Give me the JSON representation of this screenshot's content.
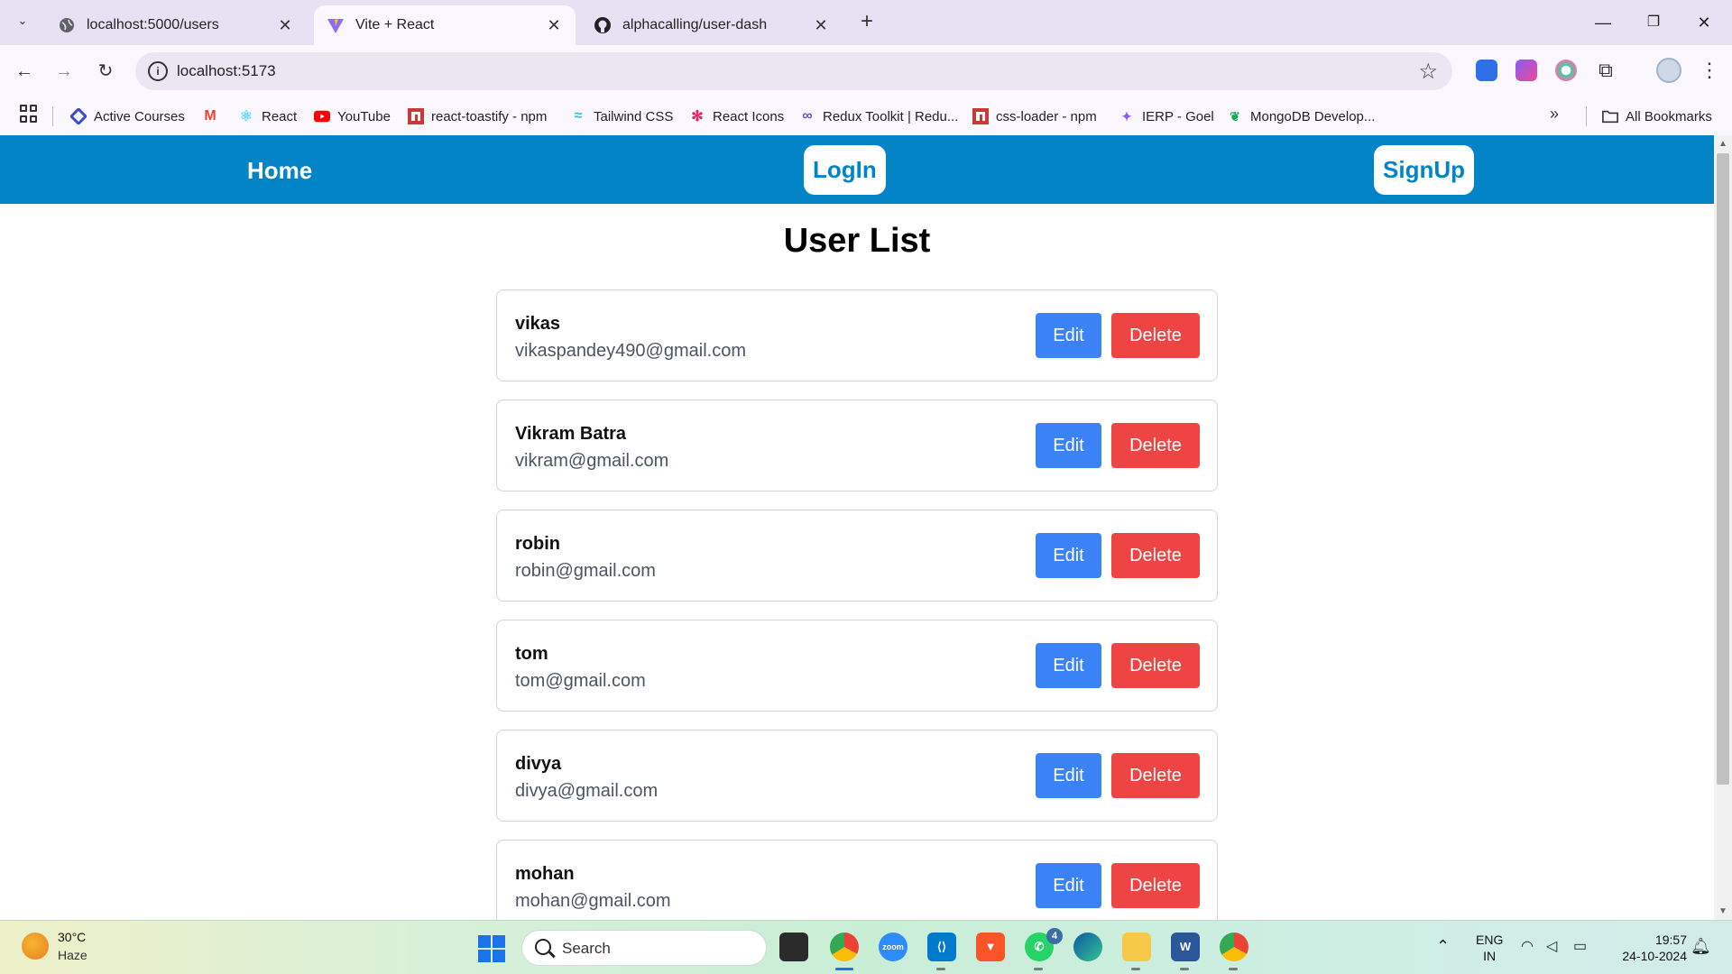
{
  "browser": {
    "tabs": [
      {
        "title": "localhost:5000/users",
        "active": false
      },
      {
        "title": "Vite + React",
        "active": true
      },
      {
        "title": "alphacalling/user-dash",
        "active": false
      }
    ],
    "url": "localhost:5173",
    "bookmarks": [
      {
        "label": "Active Courses",
        "icon": "diamond-icon"
      },
      {
        "label": "",
        "icon": "gmail-icon"
      },
      {
        "label": "React",
        "icon": "react-icon"
      },
      {
        "label": "YouTube",
        "icon": "youtube-icon"
      },
      {
        "label": "react-toastify - npm",
        "icon": "npm-icon"
      },
      {
        "label": "Tailwind CSS",
        "icon": "tailwind-icon"
      },
      {
        "label": "React Icons",
        "icon": "react-icons-icon"
      },
      {
        "label": "Redux Toolkit | Redu...",
        "icon": "redux-icon"
      },
      {
        "label": "css-loader - npm",
        "icon": "npm-icon"
      },
      {
        "label": "IERP - Goel",
        "icon": "ierp-icon"
      },
      {
        "label": "MongoDB Develop...",
        "icon": "mongodb-icon"
      }
    ],
    "all_bookmarks": "All Bookmarks"
  },
  "page": {
    "nav": {
      "home": "Home",
      "login": "LogIn",
      "signup": "SignUp"
    },
    "title": "User List",
    "edit_label": "Edit",
    "delete_label": "Delete",
    "users": [
      {
        "name": "vikas",
        "email": "vikaspandey490@gmail.com"
      },
      {
        "name": "Vikram Batra",
        "email": "vikram@gmail.com"
      },
      {
        "name": "robin",
        "email": "robin@gmail.com"
      },
      {
        "name": "tom",
        "email": "tom@gmail.com"
      },
      {
        "name": "divya",
        "email": "divya@gmail.com"
      },
      {
        "name": "mohan",
        "email": "mohan@gmail.com"
      }
    ]
  },
  "taskbar": {
    "weather_temp": "30°C",
    "weather_desc": "Haze",
    "search_placeholder": "Search",
    "whatsapp_badge": "4",
    "lang_1": "ENG",
    "lang_2": "IN",
    "time": "19:57",
    "date": "24-10-2024"
  },
  "colors": {
    "navbar": "#0284c7",
    "edit_button": "#3b82f6",
    "delete_button": "#ef4444"
  }
}
